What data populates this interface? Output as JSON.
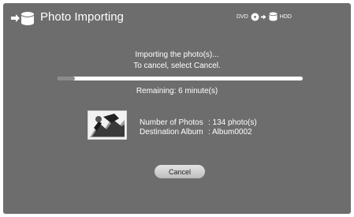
{
  "window": {
    "title": "Photo Importing",
    "header_icon": "import-to-drive-icon"
  },
  "route": {
    "source": "DVD",
    "destination": "HDD",
    "icons": [
      "disc-icon",
      "arrow-icon",
      "drive-icon"
    ]
  },
  "message": {
    "line1": "Importing the photo(s)...",
    "line2": "To cancel, select Cancel."
  },
  "progress": {
    "fraction": 0.07,
    "remaining": "Remaining: 6 minute(s)"
  },
  "details": {
    "thumbnail_icon": "photo-thumbnail",
    "photos_label": "Number of Photos",
    "photos_value": ": 134 photo(s)",
    "album_label": "Destination Album",
    "album_value": ": Album0002"
  },
  "actions": {
    "cancel_label": "Cancel"
  },
  "colors": {
    "panel": "#6d6d6d",
    "text": "#ffffff",
    "progress_track": "#ffffff",
    "progress_fill": "#8a8a8a"
  }
}
